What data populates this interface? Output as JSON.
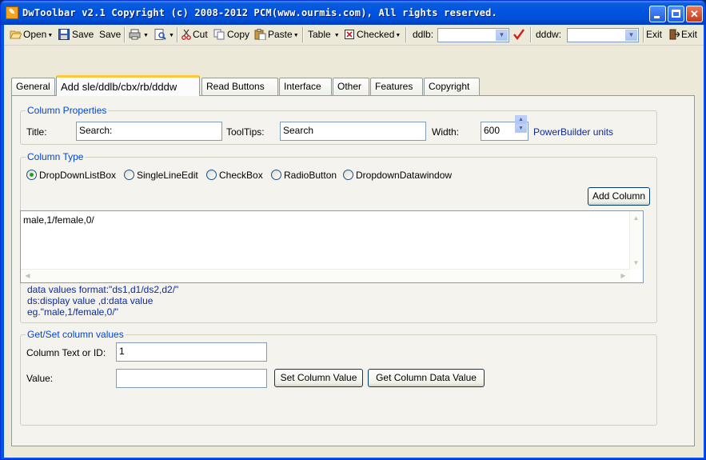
{
  "window": {
    "title": "DwToolbar v2.1 Copyright (c) 2008-2012 PCM(www.ourmis.com), All rights reserved."
  },
  "toolbar": {
    "open": "Open",
    "save": "Save",
    "save2": "Save",
    "cut": "Cut",
    "copy": "Copy",
    "paste": "Paste",
    "table": "Table",
    "checked": "Checked",
    "ddlb_label": "ddlb:",
    "dddw_label": "dddw:",
    "exit": "Exit",
    "exit2": "Exit"
  },
  "tabs": [
    {
      "label": "General"
    },
    {
      "label": "Add sle/ddlb/cbx/rb/dddw"
    },
    {
      "label": "Read Buttons"
    },
    {
      "label": "Interface"
    },
    {
      "label": "Other"
    },
    {
      "label": "Features"
    },
    {
      "label": "Copyright"
    }
  ],
  "column_properties": {
    "title": "Column Properties",
    "title_label": "Title:",
    "title_value": "Search:",
    "tooltips_label": "ToolTips:",
    "tooltips_value": "Search",
    "width_label": "Width:",
    "width_value": "600",
    "units": "PowerBuilder units"
  },
  "column_type": {
    "title": "Column Type",
    "options": [
      "DropDownListBox",
      "SingleLineEdit",
      "CheckBox",
      "RadioButton",
      "DropdownDatawindow"
    ],
    "selected": "DropDownListBox",
    "add_button": "Add Column",
    "memo_value": "male,1/female,0/",
    "help": [
      "data values format:\"ds1,d1/ds2,d2/\"",
      "ds:display value ,d:data value",
      "eg.\"male,1/female,0/\""
    ]
  },
  "get_set": {
    "title": "Get/Set column values",
    "col_label": "Column Text or ID:",
    "col_value": "1",
    "value_label": "Value:",
    "value_value": "",
    "set_button": "Set Column Value",
    "get_button": "Get Column Data Value"
  },
  "colors": {
    "titlebar": "#0054e3",
    "group_title": "#0046d5",
    "help_text": "#0c2a9c",
    "tab_active_accent": "#ffc83c"
  }
}
